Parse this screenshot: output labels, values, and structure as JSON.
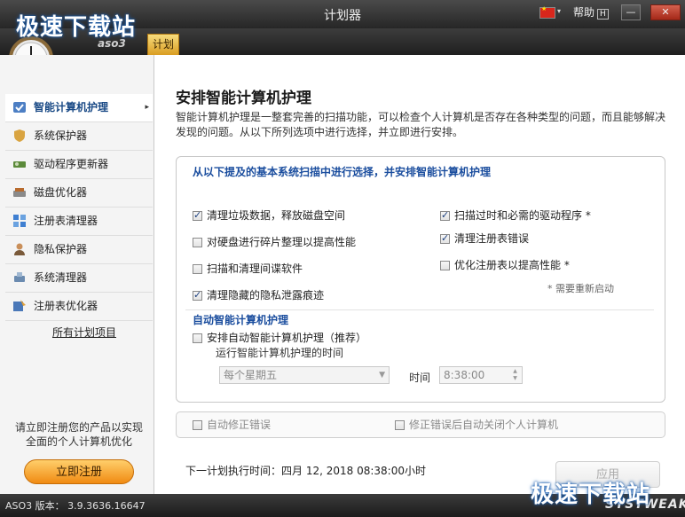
{
  "window": {
    "title": "计划器",
    "help_label": "帮助",
    "help_key": "H",
    "minimize_glyph": "—",
    "close_glyph": "✕",
    "flag_caret": "▾"
  },
  "watermark": {
    "text": "极速下载站"
  },
  "tabs": {
    "aso_label": "aso3",
    "plan_label": "计划"
  },
  "sidebar": {
    "items": [
      {
        "label": "智能计算机护理",
        "icon": "shield-check-icon",
        "active": true
      },
      {
        "label": "系统保护器",
        "icon": "shield-icon"
      },
      {
        "label": "驱动程序更新器",
        "icon": "driver-icon"
      },
      {
        "label": "磁盘优化器",
        "icon": "disk-icon"
      },
      {
        "label": "注册表清理器",
        "icon": "registry-cleaner-icon"
      },
      {
        "label": "隐私保护器",
        "icon": "privacy-icon"
      },
      {
        "label": "系统清理器",
        "icon": "broom-icon"
      },
      {
        "label": "注册表优化器",
        "icon": "registry-optimizer-icon"
      }
    ],
    "active_arrow": "▸",
    "all_plans_link": "所有计划项目",
    "promo_line1": "请立即注册您的产品以实现",
    "promo_line2": "全面的个人计算机优化",
    "register_button": "立即注册"
  },
  "main": {
    "title": "安排智能计算机护理",
    "description": "智能计算机护理是一整套完善的扫描功能，可以检查个人计算机是否存在各种类型的问题，而且能够解决发现的问题。从以下所列选项中进行选择，并立即进行安排。",
    "group_title": "从以下提及的基本系统扫描中进行选择，并安排智能计算机护理",
    "options_left": [
      {
        "label": "清理垃圾数据，释放磁盘空间",
        "checked": true
      },
      {
        "label": "对硬盘进行碎片整理以提高性能",
        "checked": false
      },
      {
        "label": "扫描和清理间谍软件",
        "checked": false
      },
      {
        "label": "清理隐藏的隐私泄露痕迹",
        "checked": true
      }
    ],
    "options_right": [
      {
        "label": "扫描过时和必需的驱动程序 *",
        "checked": true
      },
      {
        "label": "清理注册表错误",
        "checked": true
      },
      {
        "label": "优化注册表以提高性能 *",
        "checked": false
      }
    ],
    "restart_note": "* 需要重新启动",
    "auto_title": "自动智能计算机护理",
    "auto_option": {
      "label": "安排自动智能计算机护理（推荐）",
      "checked": false
    },
    "run_time_label": "运行智能计算机护理的时间",
    "day_select": "每个星期五",
    "time_label": "时间",
    "time_value": "8:38:00",
    "auto_fix": {
      "label": "自动修正错误",
      "checked": false
    },
    "auto_shutdown": {
      "label": "修正错误后自动关闭个人计算机",
      "checked": false
    },
    "next_run": "下一计划执行时间：四月 12, 2018 08:38:00小时",
    "apply_button": "应用"
  },
  "statusbar": {
    "version": "ASO3 版本： 3.9.3636.16647",
    "brand": "SYSTWEAK"
  },
  "colors": {
    "accent_blue": "#1a4d9e",
    "register_orange": "#f08a12",
    "tab_gold": "#d99d22",
    "titlebar_dark": "#262626"
  }
}
